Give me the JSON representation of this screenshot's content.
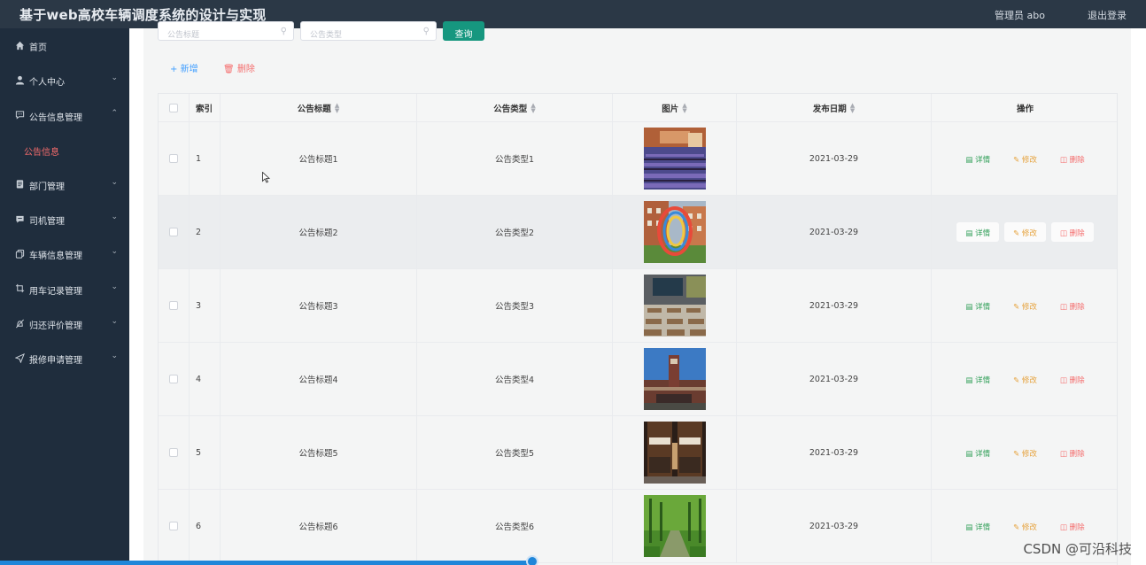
{
  "header": {
    "app_title": "基于web高校车辆调度系统的设计与实现",
    "user_label": "管理员 abo",
    "logout_label": "退出登录"
  },
  "sidebar": {
    "items": [
      {
        "label": "首页",
        "icon": "home-icon"
      },
      {
        "label": "个人中心",
        "icon": "user-icon"
      },
      {
        "label": "公告信息管理",
        "icon": "message-icon"
      },
      {
        "label": "公告信息",
        "icon": ""
      },
      {
        "label": "部门管理",
        "icon": "clipboard-icon"
      },
      {
        "label": "司机管理",
        "icon": "chat-icon"
      },
      {
        "label": "车辆信息管理",
        "icon": "copy-icon"
      },
      {
        "label": "用车记录管理",
        "icon": "crop-icon"
      },
      {
        "label": "归还评价管理",
        "icon": "mute-icon"
      },
      {
        "label": "报修申请管理",
        "icon": "send-icon"
      }
    ]
  },
  "search": {
    "title_placeholder": "公告标题",
    "type_placeholder": "公告类型",
    "query_label": "查询"
  },
  "actions": {
    "add_label": "新增",
    "delete_label": "删除"
  },
  "table": {
    "columns": [
      "索引",
      "公告标题",
      "公告类型",
      "图片",
      "发布日期",
      "操作"
    ],
    "rows": [
      {
        "index": "1",
        "title": "公告标题1",
        "type": "公告类型1",
        "date": "2021-03-29"
      },
      {
        "index": "2",
        "title": "公告标题2",
        "type": "公告类型2",
        "date": "2021-03-29"
      },
      {
        "index": "3",
        "title": "公告标题3",
        "type": "公告类型3",
        "date": "2021-03-29"
      },
      {
        "index": "4",
        "title": "公告标题4",
        "type": "公告类型4",
        "date": "2021-03-29"
      },
      {
        "index": "5",
        "title": "公告标题5",
        "type": "公告类型5",
        "date": "2021-03-29"
      },
      {
        "index": "6",
        "title": "公告标题6",
        "type": "公告类型6",
        "date": "2021-03-29"
      }
    ],
    "op_detail": "详情",
    "op_edit": "修改",
    "op_delete": "删除"
  },
  "watermark": "CSDN @可沿科技",
  "colors": {
    "header_bg": "#2b3846",
    "sidebar_bg": "#1f2d3d",
    "active_menu": "#f56c6c",
    "query_button": "#16977f",
    "detail": "#2f9e57",
    "edit": "#e6a23c",
    "delete": "#f56c6c"
  }
}
